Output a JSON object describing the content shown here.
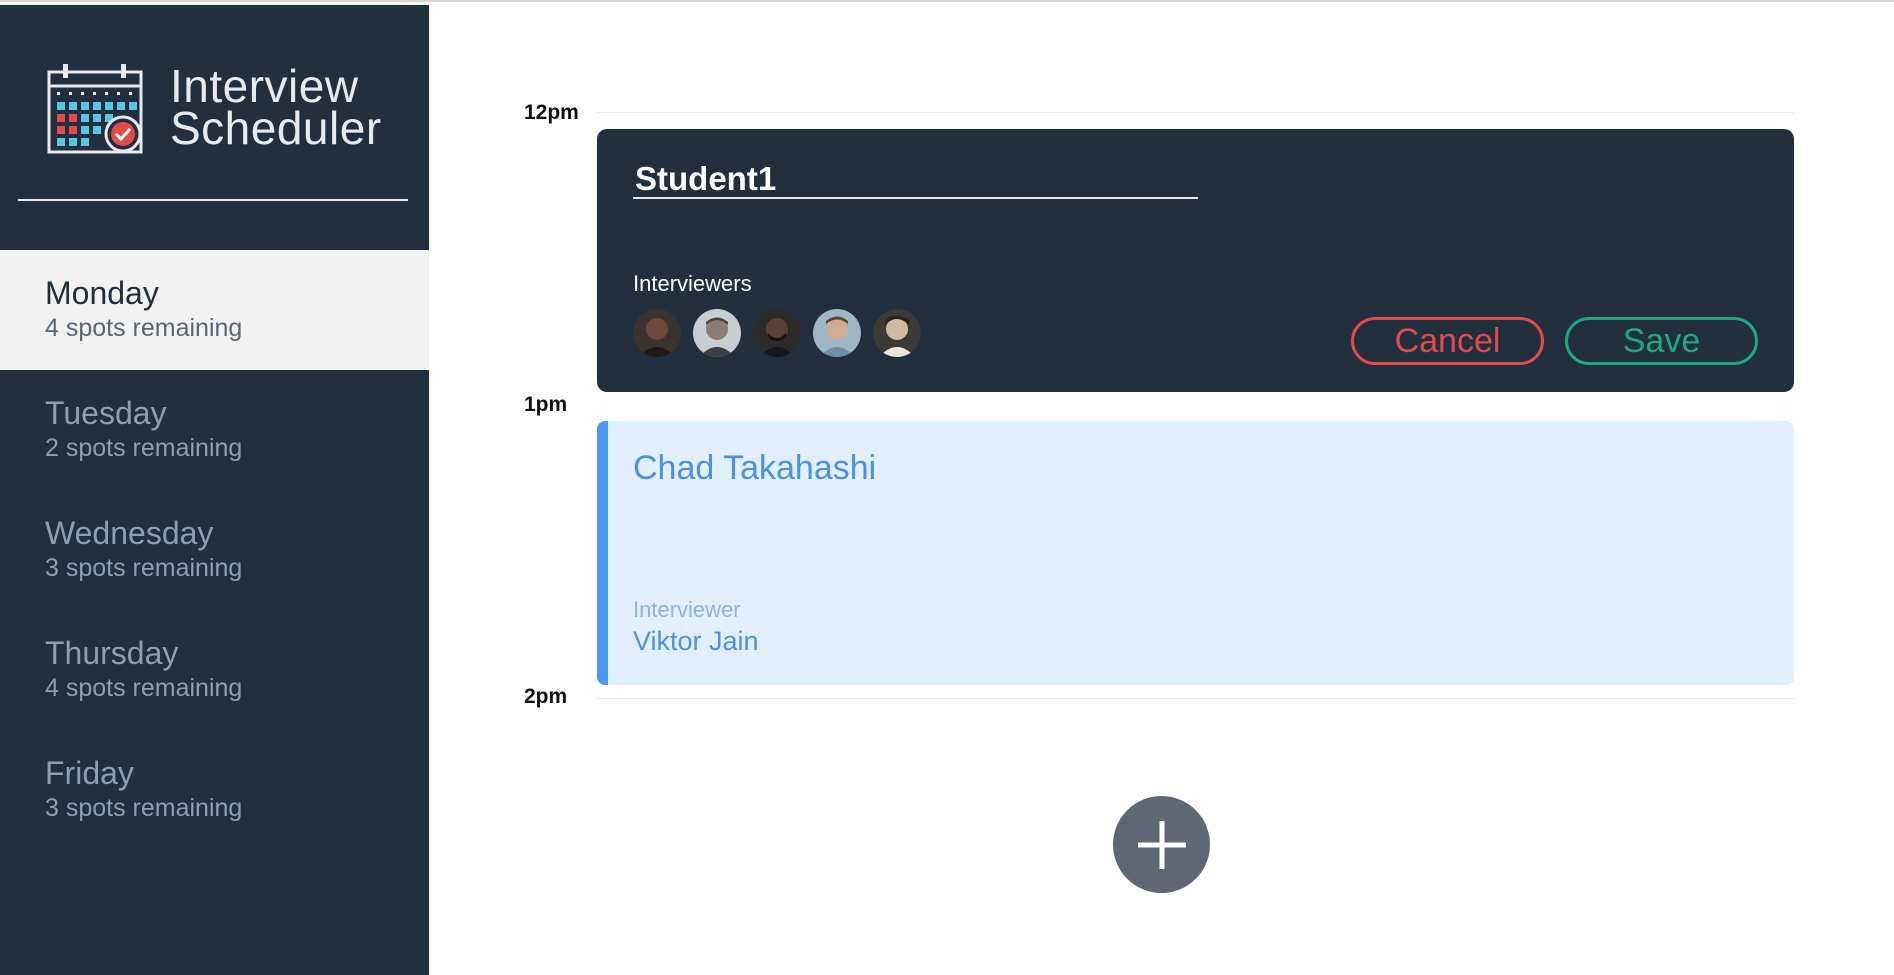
{
  "app": {
    "title_line1": "Interview",
    "title_line2": "Scheduler"
  },
  "sidebar": {
    "days": [
      {
        "name": "Monday",
        "spots": "4 spots remaining",
        "selected": true
      },
      {
        "name": "Tuesday",
        "spots": "2 spots remaining",
        "selected": false
      },
      {
        "name": "Wednesday",
        "spots": "3 spots remaining",
        "selected": false
      },
      {
        "name": "Thursday",
        "spots": "4 spots remaining",
        "selected": false
      },
      {
        "name": "Friday",
        "spots": "3 spots remaining",
        "selected": false
      }
    ]
  },
  "schedule": {
    "hours": [
      "12pm",
      "1pm",
      "2pm"
    ],
    "edit_form": {
      "student_name": "Student1",
      "interviewers_label": "Interviewers",
      "interviewer_avatars": [
        "interviewer-1",
        "interviewer-2",
        "interviewer-3",
        "interviewer-4",
        "interviewer-5"
      ],
      "cancel_label": "Cancel",
      "save_label": "Save"
    },
    "appointment": {
      "student": "Chad Takahashi",
      "interviewer_label": "Interviewer",
      "interviewer_name": "Viktor Jain"
    }
  },
  "colors": {
    "sidebar_bg": "#222f3e",
    "cancel": "#e34a4a",
    "save": "#1ea87e",
    "appointment_accent": "#4c9bf1",
    "appointment_bg": "#e1effe"
  },
  "icons": {
    "logo": "calendar-check-icon",
    "add": "plus-icon"
  }
}
